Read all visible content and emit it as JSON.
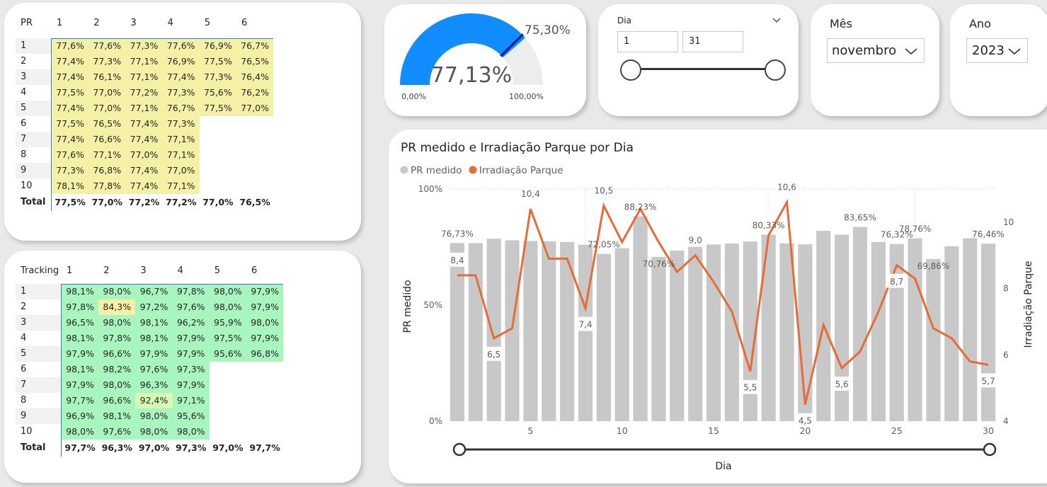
{
  "pr_matrix": {
    "corner_label": "PR",
    "columns": [
      "1",
      "2",
      "3",
      "4",
      "5",
      "6"
    ],
    "rows": [
      {
        "label": "1",
        "values": [
          "77,6%",
          "77,6%",
          "77,3%",
          "77,6%",
          "76,9%",
          "76,7%"
        ]
      },
      {
        "label": "2",
        "values": [
          "77,4%",
          "77,3%",
          "77,1%",
          "76,9%",
          "77,5%",
          "76,5%"
        ]
      },
      {
        "label": "3",
        "values": [
          "77,4%",
          "76,1%",
          "77,1%",
          "77,4%",
          "77,3%",
          "76,4%"
        ]
      },
      {
        "label": "4",
        "values": [
          "77,5%",
          "77,0%",
          "77,2%",
          "77,3%",
          "75,6%",
          "76,2%"
        ]
      },
      {
        "label": "5",
        "values": [
          "77,4%",
          "77,0%",
          "77,1%",
          "76,7%",
          "77,5%",
          "77,0%"
        ]
      },
      {
        "label": "6",
        "values": [
          "77,5%",
          "76,5%",
          "77,4%",
          "77,3%",
          "",
          ""
        ]
      },
      {
        "label": "7",
        "values": [
          "77,4%",
          "76,6%",
          "77,4%",
          "77,1%",
          "",
          ""
        ]
      },
      {
        "label": "8",
        "values": [
          "77,6%",
          "77,1%",
          "77,0%",
          "77,1%",
          "",
          ""
        ]
      },
      {
        "label": "9",
        "values": [
          "77,3%",
          "76,8%",
          "77,4%",
          "77,0%",
          "",
          ""
        ]
      },
      {
        "label": "10",
        "values": [
          "78,1%",
          "77,8%",
          "77,4%",
          "77,1%",
          "",
          ""
        ]
      }
    ],
    "total_label": "Total",
    "totals": [
      "77,5%",
      "77,0%",
      "77,2%",
      "77,2%",
      "77,0%",
      "76,5%"
    ]
  },
  "tracking_matrix": {
    "corner_label": "Tracking",
    "columns": [
      "1",
      "2",
      "3",
      "4",
      "5",
      "6"
    ],
    "rows": [
      {
        "label": "1",
        "values": [
          "98,1%",
          "98,0%",
          "96,7%",
          "97,8%",
          "98,0%",
          "97,9%"
        ]
      },
      {
        "label": "2",
        "values": [
          "97,8%",
          "84,3%",
          "97,2%",
          "97,6%",
          "98,0%",
          "97,9%"
        ]
      },
      {
        "label": "3",
        "values": [
          "96,5%",
          "98,0%",
          "98,1%",
          "96,2%",
          "95,9%",
          "98,0%"
        ]
      },
      {
        "label": "4",
        "values": [
          "98,1%",
          "97,8%",
          "98,1%",
          "97,9%",
          "97,5%",
          "97,9%"
        ]
      },
      {
        "label": "5",
        "values": [
          "97,9%",
          "96,6%",
          "97,9%",
          "97,9%",
          "95,6%",
          "96,8%"
        ]
      },
      {
        "label": "6",
        "values": [
          "98,1%",
          "98,2%",
          "97,6%",
          "97,3%",
          "",
          ""
        ]
      },
      {
        "label": "7",
        "values": [
          "97,9%",
          "98,0%",
          "96,3%",
          "97,9%",
          "",
          ""
        ]
      },
      {
        "label": "8",
        "values": [
          "97,7%",
          "96,6%",
          "92,4%",
          "97,1%",
          "",
          ""
        ]
      },
      {
        "label": "9",
        "values": [
          "96,9%",
          "98,1%",
          "98,0%",
          "95,6%",
          "",
          ""
        ]
      },
      {
        "label": "10",
        "values": [
          "98,0%",
          "97,6%",
          "98,0%",
          "98,0%",
          "",
          ""
        ]
      }
    ],
    "total_label": "Total",
    "totals": [
      "97,7%",
      "96,3%",
      "97,0%",
      "97,3%",
      "97,0%",
      "97,7%"
    ]
  },
  "gauge": {
    "value": 77.13,
    "value_label": "77,13%",
    "target": 75.3,
    "target_label": "75,30%",
    "min_label": "0,00%",
    "max_label": "100,00%",
    "fill_color": "#118dff",
    "track_color": "#eeeded",
    "target_color": "#12239e"
  },
  "dia_slicer": {
    "title": "Dia",
    "from_value": "1",
    "to_value": "31"
  },
  "mes_slicer": {
    "title": "Mês",
    "selected": "novembro"
  },
  "ano_slicer": {
    "title": "Ano",
    "selected": "2023"
  },
  "chart": {
    "title": "PR medido e Irradiação Parque por Dia",
    "legend": [
      {
        "name": "PR medido",
        "color": "#c8c8c8"
      },
      {
        "name": "Irradiação Parque",
        "color": "#e66c37"
      }
    ],
    "x_axis_title": "Dia",
    "y_left_title": "PR medido",
    "y_right_title": "Irradiação Parque",
    "y_left_ticks": [
      "0%",
      "50%",
      "100%"
    ],
    "y_right_ticks": [
      "4",
      "6",
      "8",
      "10"
    ],
    "x_ticks": [
      "5",
      "10",
      "15",
      "20",
      "25",
      "30"
    ]
  },
  "chart_data": {
    "type": "bar",
    "title": "PR medido e Irradiação Parque por Dia",
    "xlabel": "Dia",
    "ylabel": "PR medido",
    "y2label": "Irradiação Parque",
    "x": [
      1,
      2,
      3,
      4,
      5,
      6,
      7,
      8,
      9,
      10,
      11,
      12,
      13,
      14,
      15,
      16,
      17,
      18,
      19,
      20,
      21,
      22,
      23,
      24,
      25,
      26,
      27,
      28,
      29,
      30
    ],
    "ylim": [
      0,
      100
    ],
    "y2lim": [
      4,
      11
    ],
    "grid": false,
    "series": [
      {
        "name": "PR medido",
        "type": "bar",
        "axis": "left",
        "values": [
          76.73,
          76.7,
          78.6,
          77.9,
          77.6,
          77.5,
          77.2,
          76.0,
          72.05,
          74.5,
          88.23,
          70.76,
          73.5,
          75.5,
          76.1,
          76.5,
          77.4,
          80.33,
          76.6,
          76.2,
          82.0,
          80.3,
          83.65,
          77.2,
          76.32,
          78.76,
          69.86,
          75.3,
          78.8,
          76.46
        ]
      },
      {
        "name": "Irradiação Parque",
        "type": "line",
        "axis": "right",
        "values": [
          8.4,
          8.4,
          6.5,
          6.8,
          10.4,
          8.9,
          8.9,
          7.4,
          10.5,
          9.4,
          10.4,
          9.4,
          8.5,
          9.0,
          8.2,
          7.3,
          5.5,
          9.6,
          10.6,
          4.5,
          6.9,
          5.6,
          6.1,
          7.3,
          8.7,
          8.3,
          6.8,
          6.5,
          5.8,
          5.7
        ]
      }
    ],
    "data_labels": {
      "PR medido": [
        {
          "x": 1,
          "label": "76,73%"
        },
        {
          "x": 9,
          "label": "72,05%"
        },
        {
          "x": 11,
          "label": "88,23%"
        },
        {
          "x": 12,
          "label": "70,76%"
        },
        {
          "x": 18,
          "label": "80,33%"
        },
        {
          "x": 23,
          "label": "83,65%"
        },
        {
          "x": 25,
          "label": "76,32%"
        },
        {
          "x": 26,
          "label": "78,76%"
        },
        {
          "x": 27,
          "label": "69,86%"
        },
        {
          "x": 30,
          "label": "76,46%"
        }
      ],
      "Irradiação Parque": [
        {
          "x": 1,
          "label": "8,4"
        },
        {
          "x": 3,
          "label": "6,5"
        },
        {
          "x": 5,
          "label": "10,4"
        },
        {
          "x": 8,
          "label": "7,4"
        },
        {
          "x": 9,
          "label": "10,5"
        },
        {
          "x": 14,
          "label": "9,0"
        },
        {
          "x": 17,
          "label": "5,5"
        },
        {
          "x": 19,
          "label": "10,6"
        },
        {
          "x": 20,
          "label": "4,5"
        },
        {
          "x": 22,
          "label": "5,6"
        },
        {
          "x": 25,
          "label": "8,7"
        },
        {
          "x": 30,
          "label": "5,7"
        }
      ]
    }
  }
}
